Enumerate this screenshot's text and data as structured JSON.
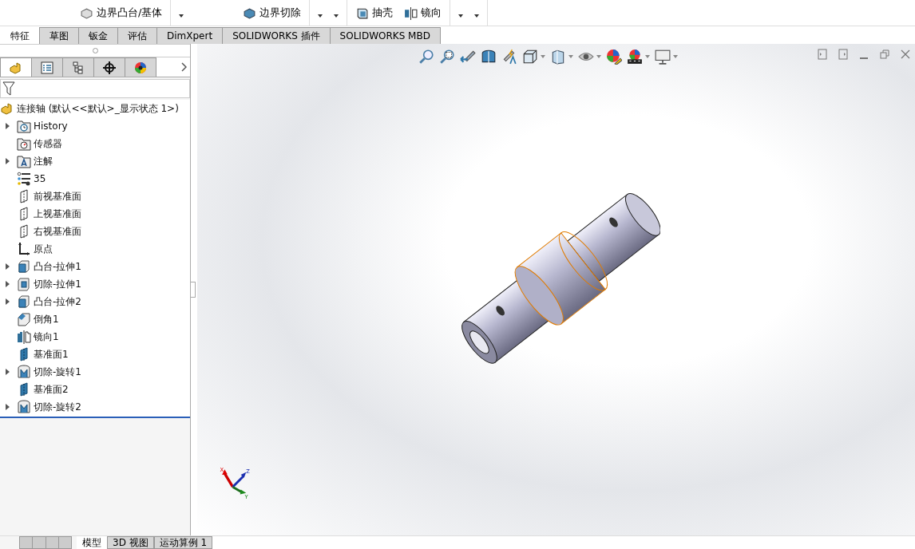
{
  "toolbar": {
    "items": [
      {
        "label": "边界凸台/基体"
      },
      {
        "label": "边界切除"
      },
      {
        "label": "抽壳"
      },
      {
        "label": "镜向"
      }
    ]
  },
  "tabs": [
    {
      "label": "特征",
      "selected": true
    },
    {
      "label": "草图",
      "selected": false
    },
    {
      "label": "钣金",
      "selected": false
    },
    {
      "label": "评估",
      "selected": false
    },
    {
      "label": "DimXpert",
      "selected": false
    },
    {
      "label": "SOLIDWORKS 插件",
      "selected": false
    },
    {
      "label": "SOLIDWORKS MBD",
      "selected": false
    }
  ],
  "panel_tabs": [
    {
      "selected": true
    },
    {
      "selected": false
    },
    {
      "selected": false
    },
    {
      "selected": false
    },
    {
      "selected": false
    }
  ],
  "tree": {
    "root": "连接轴  (默认<<默认>_显示状态 1>)",
    "items": [
      {
        "label": "History",
        "kind": "folder-history",
        "expandable": true
      },
      {
        "label": "传感器",
        "kind": "folder-sensor",
        "expandable": false
      },
      {
        "label": "注解",
        "kind": "folder-note",
        "expandable": true
      },
      {
        "label": "35",
        "kind": "material",
        "expandable": false
      },
      {
        "label": "前视基准面",
        "kind": "plane",
        "expandable": false
      },
      {
        "label": "上视基准面",
        "kind": "plane",
        "expandable": false
      },
      {
        "label": "右视基准面",
        "kind": "plane",
        "expandable": false
      },
      {
        "label": "原点",
        "kind": "origin",
        "expandable": false
      },
      {
        "label": "凸台-拉伸1",
        "kind": "extrude",
        "expandable": true
      },
      {
        "label": "切除-拉伸1",
        "kind": "cut",
        "expandable": true
      },
      {
        "label": "凸台-拉伸2",
        "kind": "extrude",
        "expandable": true
      },
      {
        "label": "倒角1",
        "kind": "chamfer",
        "expandable": false
      },
      {
        "label": "镜向1",
        "kind": "mirror",
        "expandable": false
      },
      {
        "label": "基准面1",
        "kind": "plane-solid",
        "expandable": false
      },
      {
        "label": "切除-旋转1",
        "kind": "revolve",
        "expandable": true
      },
      {
        "label": "基准面2",
        "kind": "plane-solid",
        "expandable": false
      },
      {
        "label": "切除-旋转2",
        "kind": "revolve",
        "expandable": true
      }
    ]
  },
  "triad": {
    "x": "X",
    "y": "Y",
    "z": "Z"
  },
  "bottom_tabs": [
    {
      "label": "模型",
      "selected": true
    },
    {
      "label": "3D 视图",
      "selected": false
    },
    {
      "label": "运动算例 1",
      "selected": false
    }
  ]
}
